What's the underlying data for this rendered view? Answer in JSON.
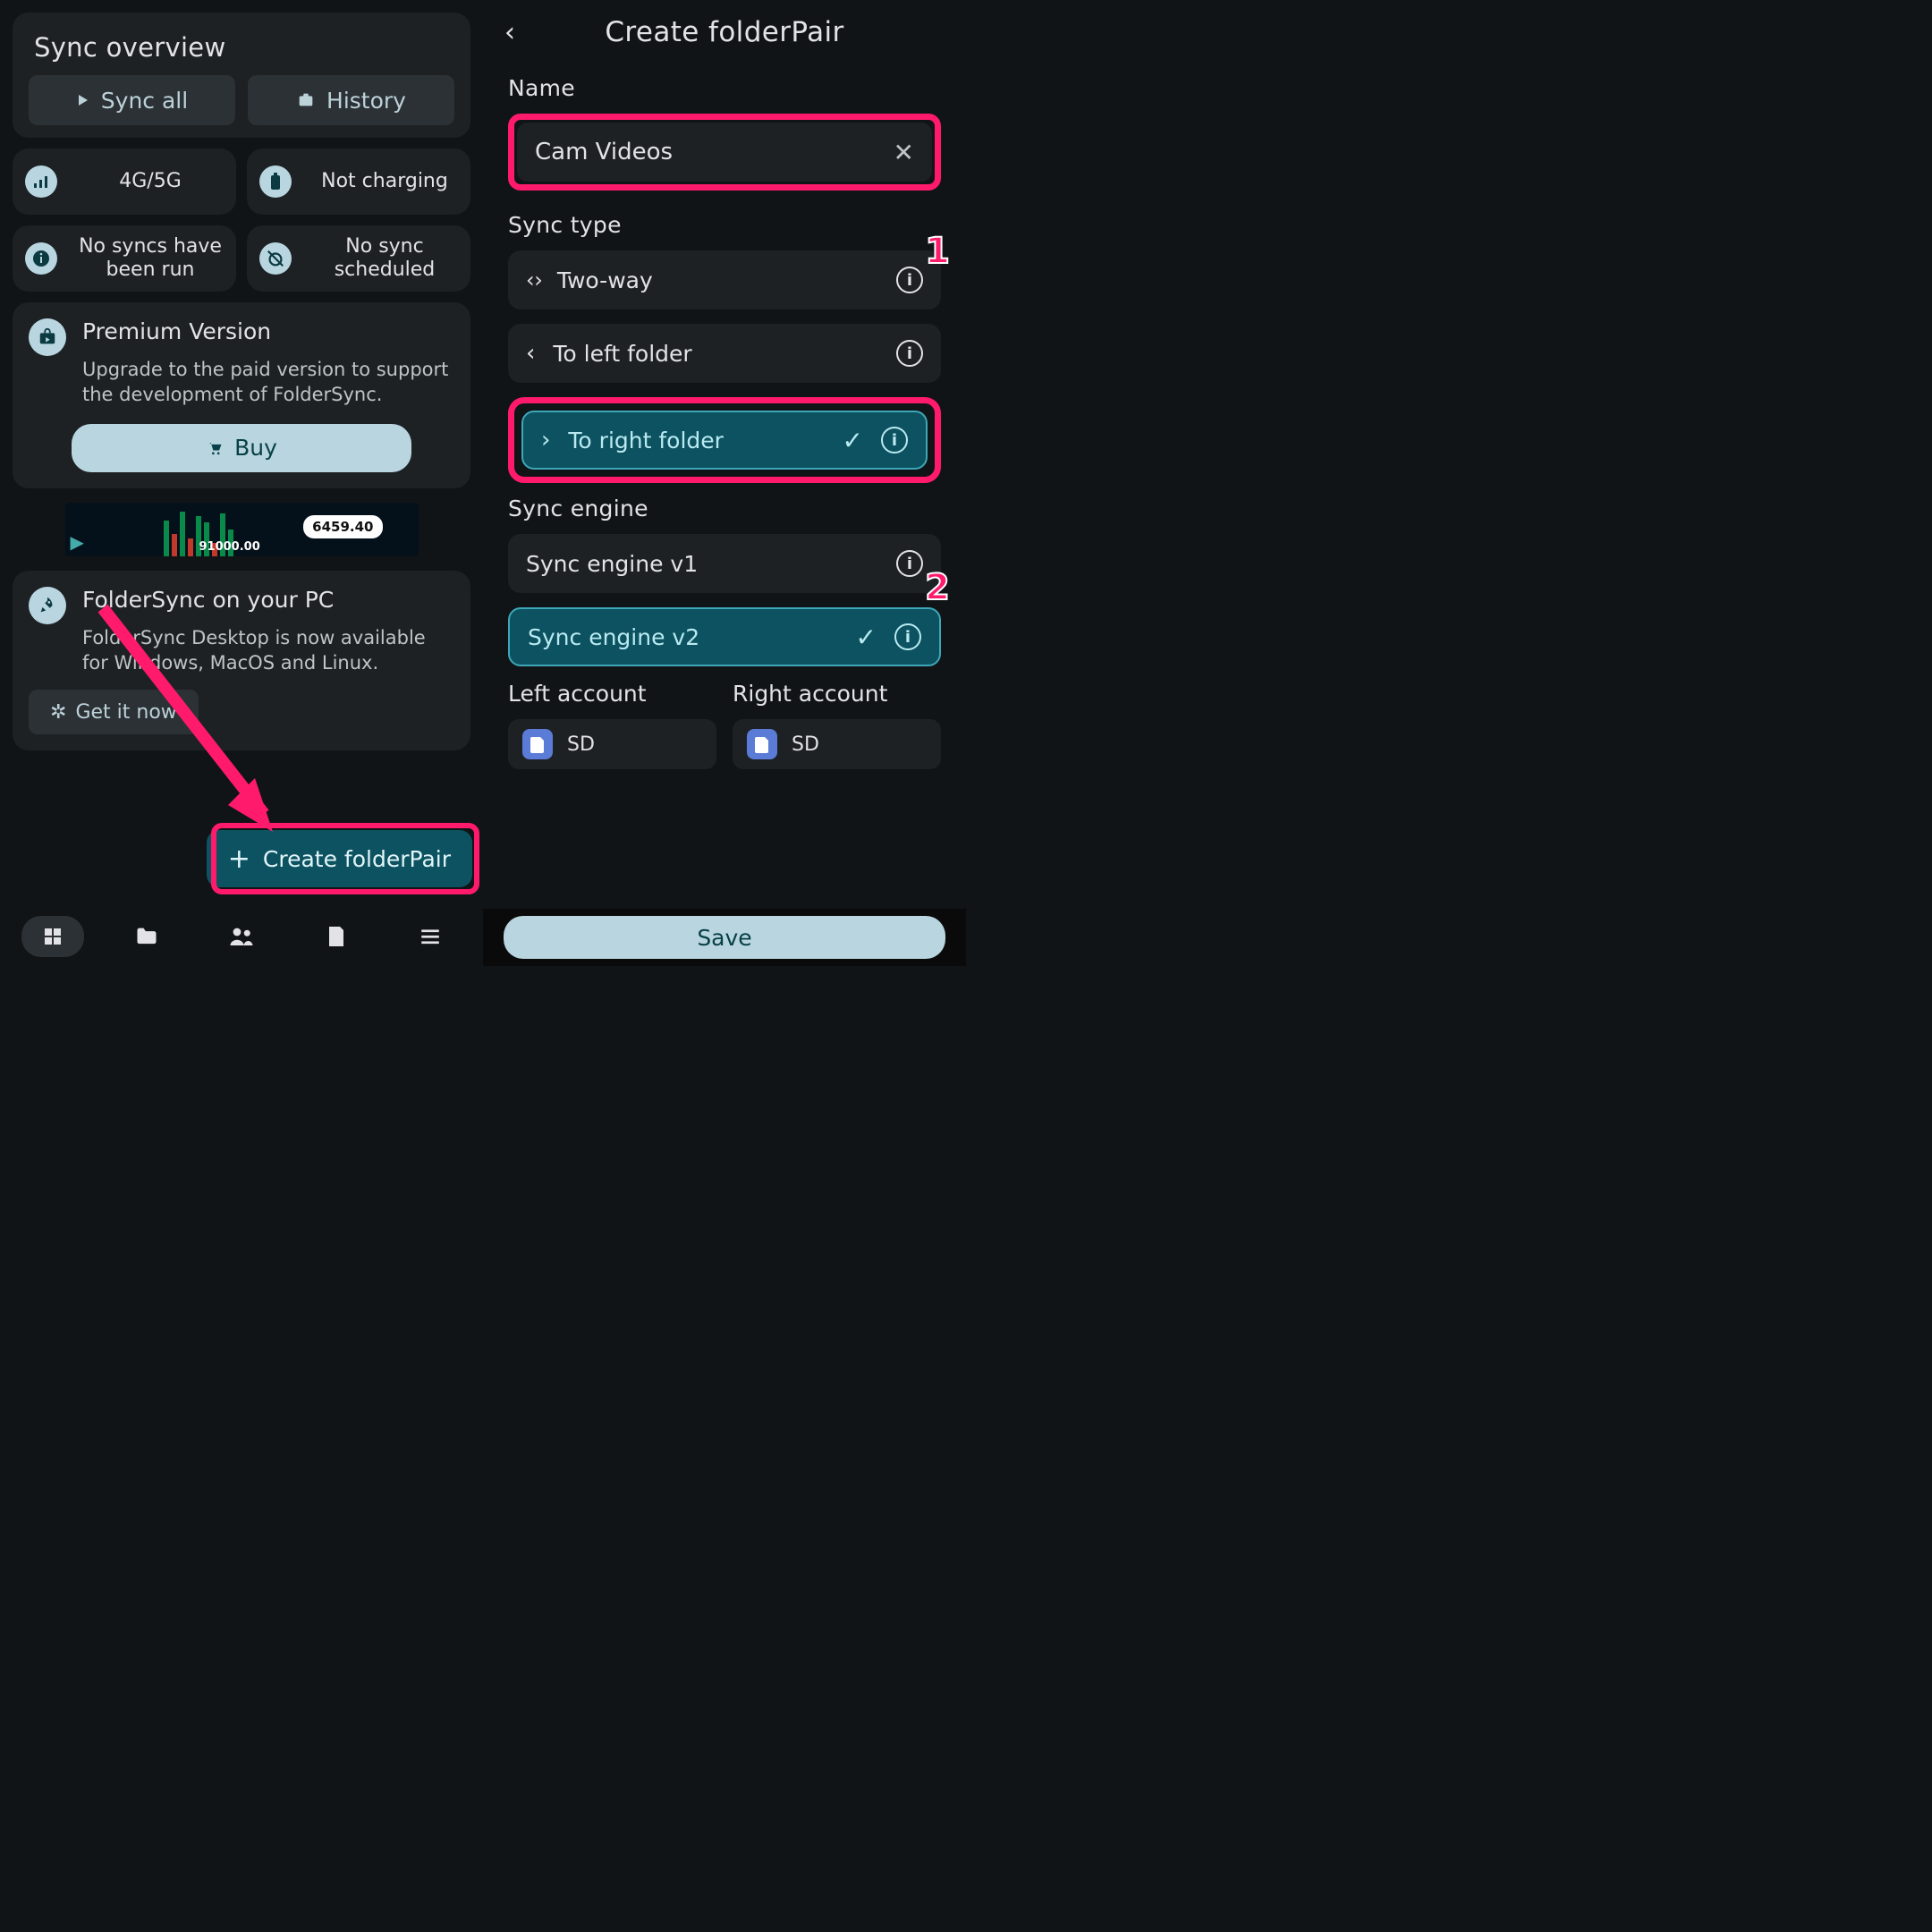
{
  "left": {
    "overview_title": "Sync overview",
    "sync_all": "Sync all",
    "history": "History",
    "stats": {
      "net": "4G/5G",
      "battery": "Not charging",
      "runs": "No syncs have been run",
      "sched": "No sync scheduled"
    },
    "premium": {
      "title": "Premium Version",
      "desc": "Upgrade to the paid version to support the development of FolderSync.",
      "buy": "Buy"
    },
    "ad": {
      "price": "6459.40",
      "low": "91000.00"
    },
    "pc": {
      "title": "FolderSync on your PC",
      "desc": "FolderSync Desktop is now available for Windows, MacOS and Linux.",
      "get": "Get it now"
    },
    "fab": "Create folderPair"
  },
  "right": {
    "title": "Create folderPair",
    "name_label": "Name",
    "name_value": "Cam Videos",
    "sync_type_label": "Sync type",
    "opts": {
      "two_way": "Two-way",
      "to_left": "To left folder",
      "to_right": "To right folder"
    },
    "engine_label": "Sync engine",
    "engines": {
      "v1": "Sync engine v1",
      "v2": "Sync engine v2"
    },
    "left_account": "Left account",
    "right_account": "Right account",
    "sd": "SD",
    "save": "Save",
    "annotations": {
      "one": "1",
      "two": "2"
    }
  }
}
